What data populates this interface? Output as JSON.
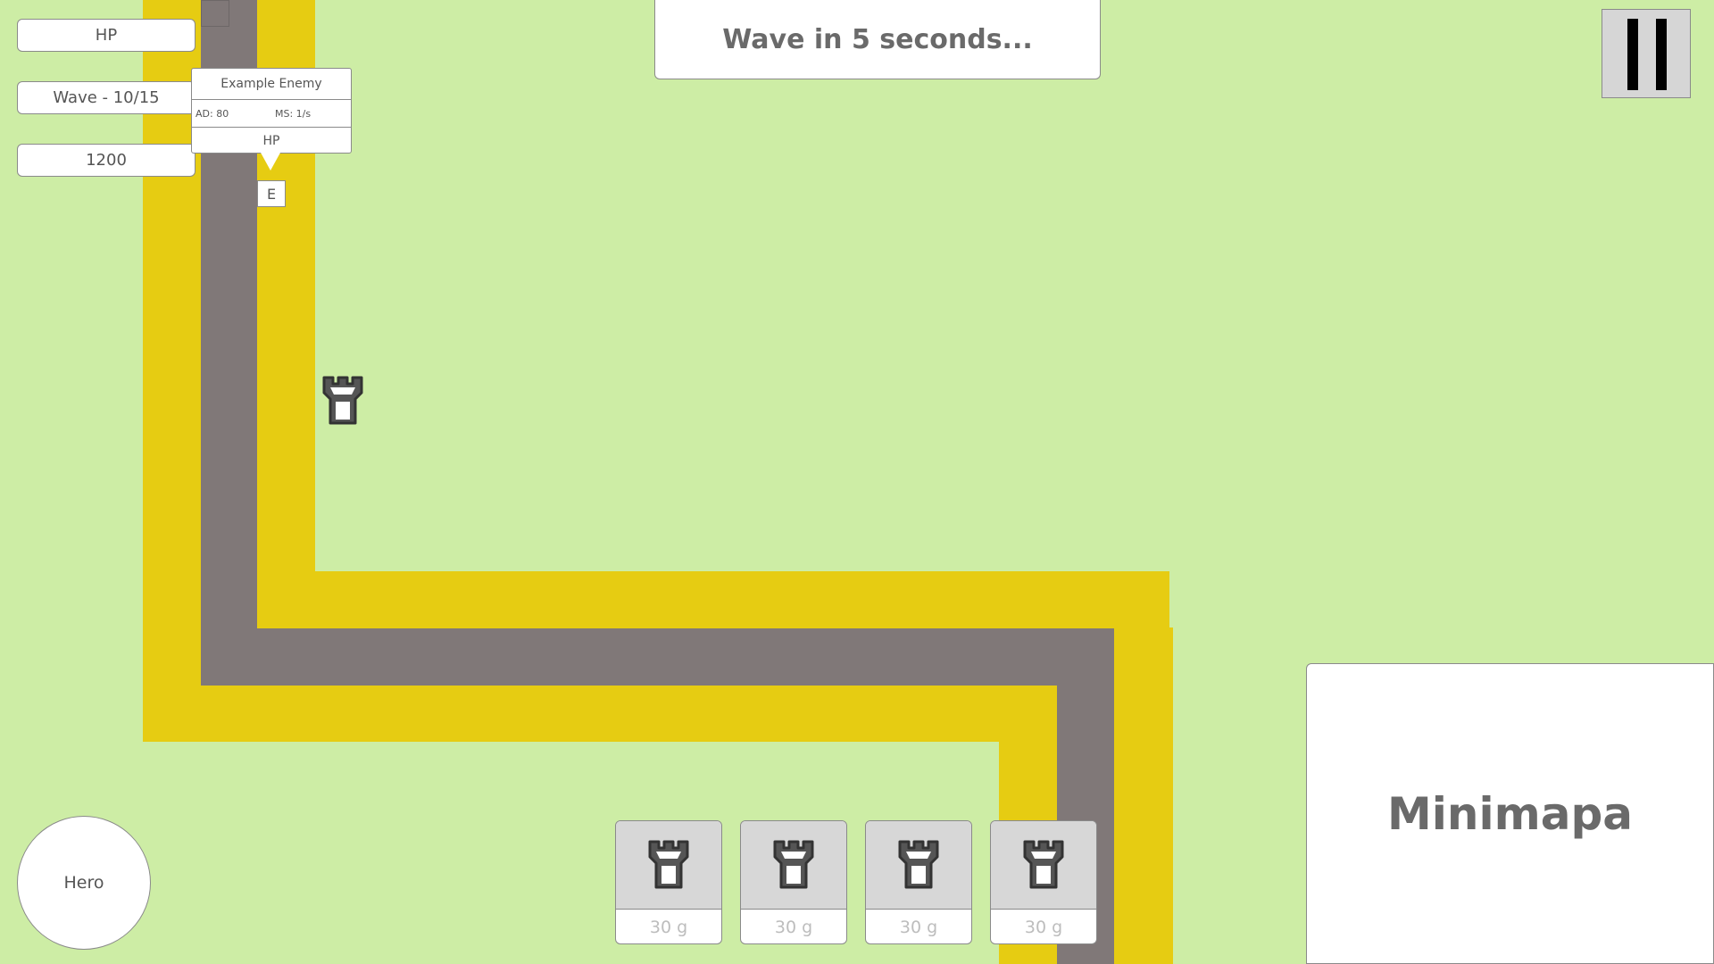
{
  "hud": {
    "hp_label": "HP",
    "wave_label": "Wave - 10/15",
    "gold": "1200"
  },
  "wave_banner": "Wave in 5 seconds...",
  "enemy_tooltip": {
    "name": "Example Enemy",
    "attack_damage": "AD: 80",
    "move_speed": "MS: 1/s",
    "hp_label": "HP"
  },
  "enemy_marker": "E",
  "shop": [
    {
      "icon": "tower-icon",
      "price": "30 g"
    },
    {
      "icon": "tower-icon",
      "price": "30 g"
    },
    {
      "icon": "tower-icon",
      "price": "30 g"
    },
    {
      "icon": "tower-icon",
      "price": "30 g"
    }
  ],
  "minimap_label": "Minimapa",
  "hero_label": "Hero",
  "colors": {
    "grass": "#cdeda5",
    "road_edge": "#e6cc12",
    "road_center": "#807878",
    "panel": "#ffffff"
  }
}
